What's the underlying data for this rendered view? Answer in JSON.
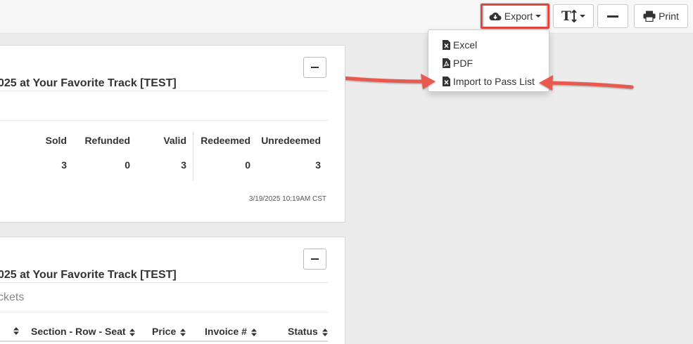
{
  "toolbar": {
    "export_label": "Export",
    "print_label": "Print",
    "font_size_label": "T"
  },
  "export_menu": {
    "items": [
      {
        "label": "Excel"
      },
      {
        "label": "PDF"
      },
      {
        "label": "Import to Pass List"
      }
    ]
  },
  "panels": [
    {
      "title": "025 at Your Favorite Track [TEST]",
      "columns": [
        "Sold",
        "Refunded",
        "Valid",
        "Redeemed",
        "Unredeemed"
      ],
      "values": [
        "3",
        "0",
        "3",
        "0",
        "3"
      ],
      "timestamp": "3/19/2025 10:19AM CST"
    },
    {
      "title": "025 at Your Favorite Track [TEST]",
      "subtitle": "ckets",
      "columns": [
        "Section - Row - Seat",
        "Price",
        "Invoice #",
        "Status"
      ]
    }
  ],
  "colors": {
    "highlight": "#e2453c",
    "arrow": "#e85a4f"
  }
}
